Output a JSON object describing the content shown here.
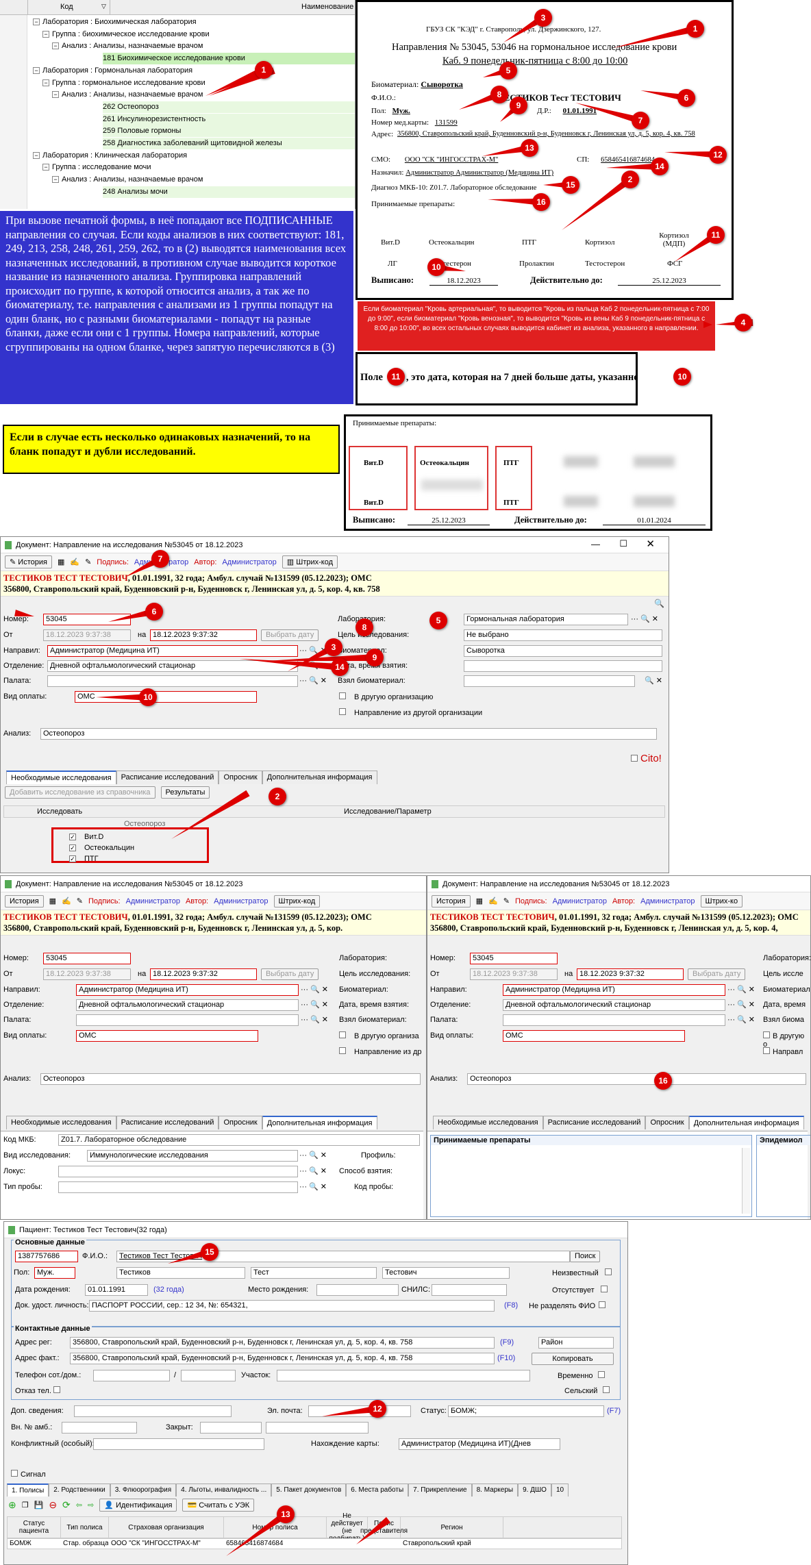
{
  "tree": {
    "col_code": "Код",
    "col_name": "Наименование",
    "rows": [
      {
        "t": "Лаборатория : Биохимическая лаборатория",
        "lvl": 0,
        "bg": ""
      },
      {
        "t": "Группа : биохимическое исследование крови",
        "lvl": 1,
        "bg": ""
      },
      {
        "t": "Анализ : Анализы, назначаемые врачом",
        "lvl": 2,
        "bg": ""
      },
      {
        "t": "181  Биохимическое исследование крови",
        "lvl": 3,
        "bg": "g2"
      },
      {
        "t": "Лаборатория : Гормональная лаборатория",
        "lvl": 0,
        "bg": ""
      },
      {
        "t": "Группа : гормональное исследование крови",
        "lvl": 1,
        "bg": ""
      },
      {
        "t": "Анализ : Анализы, назначаемые врачом",
        "lvl": 2,
        "bg": ""
      },
      {
        "t": "262  Остеопороз",
        "lvl": 3,
        "bg": "g"
      },
      {
        "t": "261  Инсулинорезистентность",
        "lvl": 3,
        "bg": "g"
      },
      {
        "t": "259  Половые гормоны",
        "lvl": 3,
        "bg": "g"
      },
      {
        "t": "258  Диагностика заболеваний щитовидной железы",
        "lvl": 3,
        "bg": "g"
      },
      {
        "t": "Лаборатория : Клиническая лаборатория",
        "lvl": 0,
        "bg": ""
      },
      {
        "t": "Группа : исследование мочи",
        "lvl": 1,
        "bg": ""
      },
      {
        "t": "Анализ : Анализы, назначаемые врачом",
        "lvl": 2,
        "bg": ""
      },
      {
        "t": "248  Анализы мочи",
        "lvl": 3,
        "bg": "g"
      }
    ]
  },
  "blank": {
    "org": "ГБУЗ СК \"КЭД\" г. Ставрополь, ул. Дзержинского, 127.",
    "title": "Направления № 53045, 53046 на гормональное исследование крови",
    "cab": "Каб. 9  понедельник-пятница с 8:00 до 10:00",
    "bio_l": "Биоматериал:",
    "bio": "Сыворотка",
    "fio_l": "Ф.И.О.:",
    "fio": "ТЕСТИКОВ Тест ТЕСТОВИЧ",
    "sex_l": "Пол:",
    "sex": "Муж.",
    "dr_l": "Д.Р.:",
    "dr": "01.01.1991",
    "card_l": "Номер мед.карты:",
    "card": "131599",
    "addr_l": "Адрес:",
    "addr": "356800, Ставропольский край, Буденновский р-н, Буденновск г, Ленинская ул, д. 5, кор. 4, кв. 758",
    "smo_l": "СМО:",
    "smo": "ООО \"СК \"ИНГОССТРАХ-М\"",
    "sp_l": "СП:",
    "sp": "658465416874684",
    "nazn_l": "Назначил:",
    "nazn": "Администратор Администратор (Медицина ИТ)",
    "mkb_l": "Диагноз МКБ-10:",
    "mkb": "Z01.7. Лабораторное обследование",
    "prep": "Принимаемые препараты:",
    "row1": [
      "Вит.D",
      "Остеокальцин",
      "ПТГ",
      "Кортизол",
      "Кортизол (МДП)"
    ],
    "row2": [
      "ЛГ",
      "Прогестерон",
      "Пролактин",
      "Тестостерон",
      "ФСГ"
    ],
    "issued_l": "Выписано:",
    "issued": "18.12.2023",
    "valid_l": "Действительно до:",
    "valid": "25.12.2023"
  },
  "blue_note": "При вызове печатной формы, в неё попадают все ПОДПИСАННЫЕ направления со случая. Если коды анализов в них соответствуют: 181, 249, 213, 258, 248, 261, 259, 262, то в (2) выводятся наименования всех назначенных исследований, в противном случае выводится короткое название из назначенного анализа. Группировка направлений происходит по группе, к которой относится анализ, а так же по биоматериалу, т.е. направления с анализами из 1 группы попадут на один бланк, но с разными биоматериалами - попадут на разные бланки, даже если они с 1 группы. Номера направлений, которые сгруппированы на одном бланке, через запятую перечисляются в (3)",
  "red_note": "Если биоматериал \"Кровь артериальная\", то выводится \"Кровь из пальца Каб 2 понедельник-пятница с 7:00 до 9:00\", если биоматериал \"Кровь венозная\", то выводится \"Кровь из вены Каб 9 понедельник-пятница с 8:00 до 10:00\", во всех остальных случаях выводится кабинет из анализа, указанного в  направлении.",
  "field_note": {
    "a": "Поле",
    "b": ", это дата, которая на 7 дней больше даты, указанной в"
  },
  "yellow_note": "Если в случае есть несколько одинаковых назначений, то на бланк попадут и дубли исследований.",
  "dup": {
    "prep": "Принимаемые препараты:",
    "t1": [
      "Вит.D",
      "Остеокальцин",
      "ПТГ"
    ],
    "b1": [
      "Вит.D",
      "",
      "ПТГ"
    ],
    "issued_l": "Выписано:",
    "issued": "25.12.2023",
    "valid_l": "Действительно до:",
    "valid": "01.01.2024"
  },
  "doc": {
    "title": "Документ: Направление на исследования №53045 от 18.12.2023",
    "history": "История",
    "sign": "Подпись:",
    "admin": "Администратор",
    "author": "Автор:",
    "barcode": "Штрих-код",
    "pat1": "ТЕСТИКОВ ТЕСТ ТЕСТОВИЧ",
    "pat1b": ", 01.01.1991, 32 года; Амбул. случай №131599 (05.12.2023); ОМС",
    "pat2": "356800, Ставропольский край, Буденновский р-н, Буденновск г, Ленинская ул, д. 5, кор. 4, кв. 758",
    "num_l": "Номер:",
    "num": "53045",
    "from_l": "От",
    "from": "18.12.2023 9:37:38",
    "to_l": "на",
    "to": "18.12.2023 9:37:32",
    "pick": "Выбрать дату",
    "dir_l": "Направил:",
    "dir": "Администратор (Медицина ИТ)",
    "dep_l": "Отделение:",
    "dep": "Дневной офтальмологический стационар",
    "ward_l": "Палата:",
    "pay_l": "Вид оплаты:",
    "pay": "ОМС",
    "lab_l": "Лаборатория:",
    "lab": "Гормональная лаборатория",
    "goal_l": "Цель исследования:",
    "goal": "Не выбрано",
    "bio_l": "Биоматериал:",
    "bio": "Сыворотка",
    "dt_l": "Дата, время взятия:",
    "took_l": "Взял биоматериал:",
    "other_org": "В другую организацию",
    "from_org": "Направление из другой организации",
    "an_l": "Анализ:",
    "an": "Остеопороз",
    "cito": "Cito!",
    "tabs": [
      "Необходимые исследования",
      "Расписание исследований",
      "Опросник",
      "Дополнительная информация"
    ],
    "add_btn": "Добавить исследование из справочника",
    "res_btn": "Результаты",
    "col1": "Исследовать",
    "col2": "Исследование/Параметр",
    "items": [
      "Остеопороз",
      "Вит.D",
      "Остеокальцин",
      "ПТГ"
    ]
  },
  "doc2": {
    "title": "Документ: Направление на исследования №53045 от 18.12.2023",
    "pat1": "ТЕСТИКОВ ТЕСТ ТЕСТОВИЧ",
    "pat1b": ", 01.01.1991, 32 года; Амбул. случай №131599 (05.12.2023); ОМС",
    "pat2": "356800, Ставропольский край, Буденновский р-н, Буденновск г, Ленинская ул, д. 5, кор.",
    "lab_l": "Лаборатория:",
    "goal_l": "Цель исследования:",
    "bio_l": "Биоматериал:",
    "dt_l": "Дата, время взятия:",
    "took_l": "Взял биоматериал:",
    "other_org": "В другую организа",
    "from_org": "Направление из др",
    "mkb_l": "Код МКБ:",
    "mkb": "Z01.7. Лабораторное обследование",
    "type_l": "Вид исследования:",
    "type": "Иммунологические исследования",
    "profile_l": "Профиль:",
    "locus_l": "Локус:",
    "method_l": "Способ взятия:",
    "probe_l": "Тип пробы:",
    "probecode_l": "Код пробы:"
  },
  "doc3": {
    "pat2": "356800, Ставропольский край, Буденновский р-н, Буденновск г, Ленинская ул, д. 5, кор. 4,",
    "lab_l": "Лаборатория:",
    "goal_l": "Цель иссле",
    "bio_l": "Биоматериал:",
    "dt_l": "Дата, время",
    "took_l": "Взял биома",
    "other_org": "В другую о",
    "from_org": "Направл",
    "barcode": "Штрих-ко",
    "prep": "Принимаемые препараты",
    "epid": "Эпидемиол"
  },
  "patient": {
    "title": "Пациент: Тестиков Тест Тестович(32 года)",
    "main": "Основные данные",
    "id": "1387757686",
    "fio_l": "Ф.И.О.:",
    "fio": "Тестиков Тест Тестович",
    "search": "Поиск",
    "sex_l": "Пол:",
    "sex": "Муж.",
    "f1": "Тестиков",
    "f2": "Тест",
    "f3": "Тестович",
    "unknown": "Неизвестный",
    "dob_l": "Дата рождения:",
    "dob": "01.01.1991",
    "age": "(32 года)",
    "pob_l": "Место рождения:",
    "snils_l": "СНИЛС:",
    "absent": "Отсутствует",
    "doc_l": "Док. удост. личность:",
    "doc": "ПАСПОРТ РОССИИ, сер.: 12 34, №: 654321,",
    "f8": "(F8)",
    "nosplit": "Не разделять ФИО",
    "contacts": "Контактные данные",
    "reg_l": "Адрес рег:",
    "reg": "356800, Ставропольский край, Буденновский р-н, Буденновск г, Ленинская ул, д. 5, кор. 4, кв. 758",
    "f9": "(F9)",
    "rayon": "Район",
    "fact_l": "Адрес факт.:",
    "fact": "356800, Ставропольский край, Буденновский р-н, Буденновск г, Ленинская ул, д. 5, кор. 4, кв. 758",
    "f10": "(F10)",
    "copy": "Копировать",
    "phone_l": "Телефон сот./дом.:",
    "uch_l": "Участок:",
    "temp": "Временно",
    "rural": "Сельский",
    "deny": "Отказ тел.",
    "extra_l": "Доп. сведения:",
    "email_l": "Эл. почта:",
    "status_l": "Статус:",
    "status": "БОМЖ;",
    "f7": "(F7)",
    "amb_l": "Вн. № амб.:",
    "closed_l": "Закрыт:",
    "conf_l": "Конфликтный (особый):",
    "loc_l": "Нахождение карты:",
    "loc": "Администратор (Медицина ИТ)(Днев",
    "signal": "Сигнал",
    "tabs": [
      "1. Полисы",
      "2. Родственники",
      "3. Флюорография",
      "4. Льготы, инвалидность ...",
      "5. Пакет документов",
      "6. Места работы",
      "7. Прикрепление",
      "8. Маркеры",
      "9. ДШО",
      "10"
    ],
    "ident": "Идентификация",
    "read": "Считать с УЭК",
    "cols": [
      "Статус пациента",
      "Тип полиса",
      "Страховая организация",
      "Номер полиса",
      "Не действует (не подбирать)",
      "Полис представителя",
      "Регион"
    ],
    "row": [
      "БОМЖ",
      "Стар. образца",
      "ООО \"СК \"ИНГОССТРАХ-М\"",
      "658465416874684",
      "",
      "",
      "Ставропольский край"
    ]
  }
}
